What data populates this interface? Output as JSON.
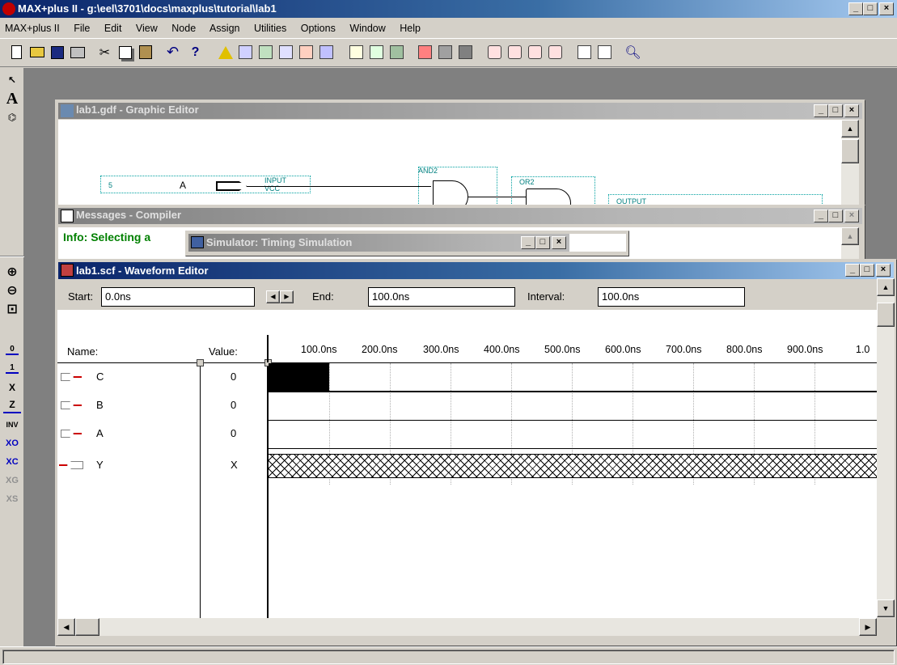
{
  "app": {
    "title": "MAX+plus II - g:\\eel\\3701\\docs\\maxplus\\tutorial\\lab1",
    "menu": [
      "MAX+plus II",
      "File",
      "Edit",
      "View",
      "Node",
      "Assign",
      "Utilities",
      "Options",
      "Window",
      "Help"
    ],
    "caption_buttons": {
      "minimize": "_",
      "maximize": "□",
      "close": "×"
    }
  },
  "toolbar": {
    "icons": [
      "new-file-icon",
      "open-file-icon",
      "save-icon",
      "print-icon",
      "cut-icon",
      "copy-icon",
      "paste-icon",
      "undo-icon",
      "help-pointer-icon",
      "compiler-icon",
      "design-doctor-icon",
      "floorplan-icon",
      "timing-analyzer-icon",
      "programmer-icon",
      "simulator-icon",
      "hierarchy-icon",
      "project-set-icon",
      "project-save-icon",
      "save-check-icon",
      "save-compile-icon",
      "save-simulate-icon",
      "find-node-icon",
      "find-node-in-design-icon",
      "find-clique-icon",
      "find-pin-icon",
      "tile-icon",
      "cascade-icon",
      "zoom-icon"
    ],
    "undo_glyph": "↶",
    "help_glyph": "?"
  },
  "left_tools": {
    "pointer": "↖",
    "text": "A",
    "wire": "⌬",
    "zoom_in": "⊕",
    "zoom_out": "⊖",
    "fit": "⊡",
    "force_0": "0",
    "force_1": "1",
    "force_x": "X",
    "force_z": "Z",
    "invert": "INV",
    "overwrite_count": "XO",
    "overwrite_clock": "XC",
    "group": "XG",
    "seq": "XS"
  },
  "graphic_editor": {
    "title": "lab1.gdf - Graphic Editor",
    "labels": {
      "input": "INPUT",
      "vcc": "VCC",
      "and2": "AND2",
      "or2": "OR2",
      "output": "OUTPUT",
      "pin": "A",
      "pin_num": "5"
    }
  },
  "messages": {
    "title": "Messages - Compiler",
    "line1": "Info: Selecting a"
  },
  "simulator": {
    "title": "Simulator: Timing Simulation"
  },
  "waveform": {
    "title": "lab1.scf - Waveform Editor",
    "start_label": "Start:",
    "start_value": "0.0ns",
    "end_label": "End:",
    "end_value": "100.0ns",
    "interval_label": "Interval:",
    "interval_value": "100.0ns",
    "name_header": "Name:",
    "value_header": "Value:",
    "ticks": [
      "100.0ns",
      "200.0ns",
      "300.0ns",
      "400.0ns",
      "500.0ns",
      "600.0ns",
      "700.0ns",
      "800.0ns",
      "900.0ns",
      "1.0"
    ],
    "signals": [
      {
        "name": "C",
        "value": "0",
        "type": "input"
      },
      {
        "name": "B",
        "value": "0",
        "type": "input"
      },
      {
        "name": "A",
        "value": "0",
        "type": "input"
      },
      {
        "name": "Y",
        "value": "X",
        "type": "output"
      }
    ]
  },
  "colors": {
    "title_active": "#0a246a",
    "title_inactive": "#808080",
    "face": "#d4d0c8",
    "pin_red": "#cc0000",
    "info_green": "#008000"
  }
}
